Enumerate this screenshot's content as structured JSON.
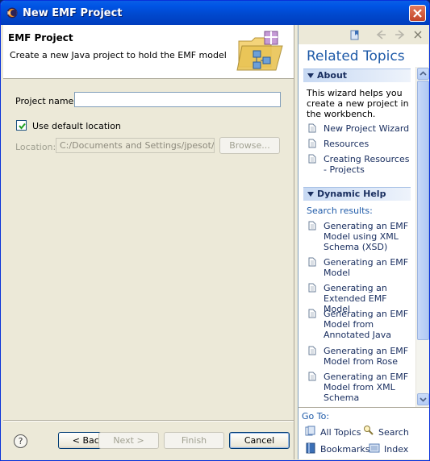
{
  "window": {
    "title": "New EMF Project"
  },
  "banner": {
    "title": "EMF Project",
    "description": "Create a new Java project to hold the EMF model"
  },
  "form": {
    "project_name_label": "Project name:",
    "project_name_value": "",
    "use_default_location_label": "Use default location",
    "use_default_location_checked": true,
    "location_label": "Location:",
    "location_value": "C:/Documents and Settings/jpesot/Des",
    "browse_label": "Browse..."
  },
  "buttons": {
    "help": "?",
    "back": "< Back",
    "next": "Next >",
    "finish": "Finish",
    "cancel": "Cancel"
  },
  "help_pane": {
    "title": "Related Topics",
    "about": {
      "heading": "About",
      "text_lines": [
        "This wizard helps you",
        "create a new project in",
        "the workbench."
      ],
      "links": [
        {
          "label_lines": [
            "New Project Wizard"
          ]
        },
        {
          "label_lines": [
            "Resources"
          ]
        },
        {
          "label_lines": [
            "Creating Resources",
            "- Projects"
          ]
        }
      ]
    },
    "dynamic_help": {
      "heading": "Dynamic Help",
      "search_results_label": "Search results:",
      "results": [
        {
          "label_lines": [
            "Generating an EMF",
            "Model using XML",
            "Schema (XSD)"
          ]
        },
        {
          "label_lines": [
            "Generating an EMF",
            "Model"
          ]
        },
        {
          "label_lines": [
            "Generating an",
            "Extended EMF Model"
          ]
        },
        {
          "label_lines": [
            "Generating an EMF",
            "Model from",
            "Annotated Java"
          ]
        },
        {
          "label_lines": [
            "Generating an EMF",
            "Model from Rose"
          ]
        },
        {
          "label_lines": [
            "Generating an EMF",
            "Model from XML",
            "Schema"
          ]
        }
      ]
    },
    "goto": {
      "label": "Go To:",
      "all_topics": "All Topics",
      "search": "Search",
      "bookmarks": "Bookmarks",
      "index": "Index"
    }
  },
  "colors": {
    "titlebar": "#0055e5",
    "link": "#1a2f60",
    "heading_blue": "#1e5aa8"
  }
}
